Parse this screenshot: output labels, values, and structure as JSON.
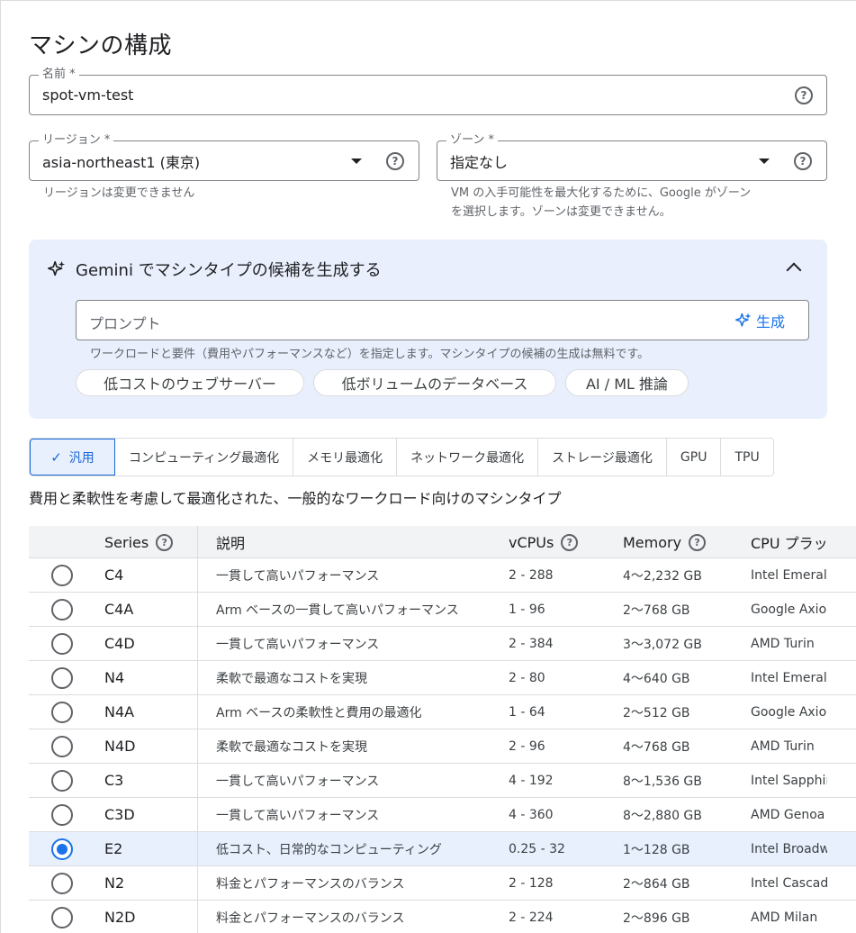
{
  "page": {
    "title": "マシンの構成"
  },
  "name_field": {
    "label": "名前 *",
    "value": "spot-vm-test"
  },
  "region_field": {
    "label": "リージョン *",
    "value": "asia-northeast1 (東京)",
    "hint": "リージョンは変更できません"
  },
  "zone_field": {
    "label": "ゾーン *",
    "value": "指定なし",
    "hint_line1": "VM の入手可能性を最大化するために、Google がゾーン",
    "hint_line2": "を選択します。ゾーンは変更できません。"
  },
  "gemini": {
    "title": "Gemini でマシンタイプの候補を生成する",
    "prompt_placeholder": "プロンプト",
    "generate_label": "生成",
    "hint": "ワークロードと要件（費用やパフォーマンスなど）を指定します。マシンタイプの候補の生成は無料です。",
    "chips": [
      "低コストのウェブサーバー",
      "低ボリュームのデータベース",
      "AI / ML 推論"
    ]
  },
  "tabs": [
    "汎用",
    "コンピューティング最適化",
    "メモリ最適化",
    "ネットワーク最適化",
    "ストレージ最適化",
    "GPU",
    "TPU"
  ],
  "tab_description": "費用と柔軟性を考慮して最適化された、一般的なワークロード向けのマシンタイプ",
  "table": {
    "headers": {
      "series": "Series",
      "desc": "説明",
      "vcpus": "vCPUs",
      "memory": "Memory",
      "cpu": "CPU プラッ"
    },
    "rows": [
      {
        "series": "C4",
        "desc": "一貫して高いパフォーマンス",
        "vcpus": "2 - 288",
        "memory": "4～2,232 GB",
        "cpu": "Intel Emerald"
      },
      {
        "series": "C4A",
        "desc": "Arm ベースの一貫して高いパフォーマンス",
        "vcpus": "1 - 96",
        "memory": "2～768 GB",
        "cpu": "Google Axion"
      },
      {
        "series": "C4D",
        "desc": "一貫して高いパフォーマンス",
        "vcpus": "2 - 384",
        "memory": "3～3,072 GB",
        "cpu": "AMD Turin"
      },
      {
        "series": "N4",
        "desc": "柔軟で最適なコストを実現",
        "vcpus": "2 - 80",
        "memory": "4～640 GB",
        "cpu": "Intel Emerald"
      },
      {
        "series": "N4A",
        "desc": "Arm ベースの柔軟性と費用の最適化",
        "vcpus": "1 - 64",
        "memory": "2～512 GB",
        "cpu": "Google Axion"
      },
      {
        "series": "N4D",
        "desc": "柔軟で最適なコストを実現",
        "vcpus": "2 - 96",
        "memory": "4～768 GB",
        "cpu": "AMD Turin"
      },
      {
        "series": "C3",
        "desc": "一貫して高いパフォーマンス",
        "vcpus": "4 - 192",
        "memory": "8～1,536 GB",
        "cpu": "Intel Sapphire"
      },
      {
        "series": "C3D",
        "desc": "一貫して高いパフォーマンス",
        "vcpus": "4 - 360",
        "memory": "8～2,880 GB",
        "cpu": "AMD Genoa"
      },
      {
        "series": "E2",
        "desc": "低コスト、日常的なコンピューティング",
        "vcpus": "0.25 - 32",
        "memory": "1～128 GB",
        "cpu": "Intel Broadw"
      },
      {
        "series": "N2",
        "desc": "料金とパフォーマンスのバランス",
        "vcpus": "2 - 128",
        "memory": "2～864 GB",
        "cpu": "Intel Cascade"
      },
      {
        "series": "N2D",
        "desc": "料金とパフォーマンスのバランス",
        "vcpus": "2 - 224",
        "memory": "2～896 GB",
        "cpu": "AMD Milan"
      }
    ],
    "selected_series": "E2"
  },
  "icons": {
    "help": "help-circle-icon",
    "dropdown": "dropdown-arrow-icon",
    "sparkle": "sparkle-icon",
    "collapse": "chevron-up-icon",
    "check": "check-icon"
  },
  "colors": {
    "accent": "#1a73e8",
    "gemini_bg": "#e9effc",
    "selected_row": "#e8f0fe"
  }
}
